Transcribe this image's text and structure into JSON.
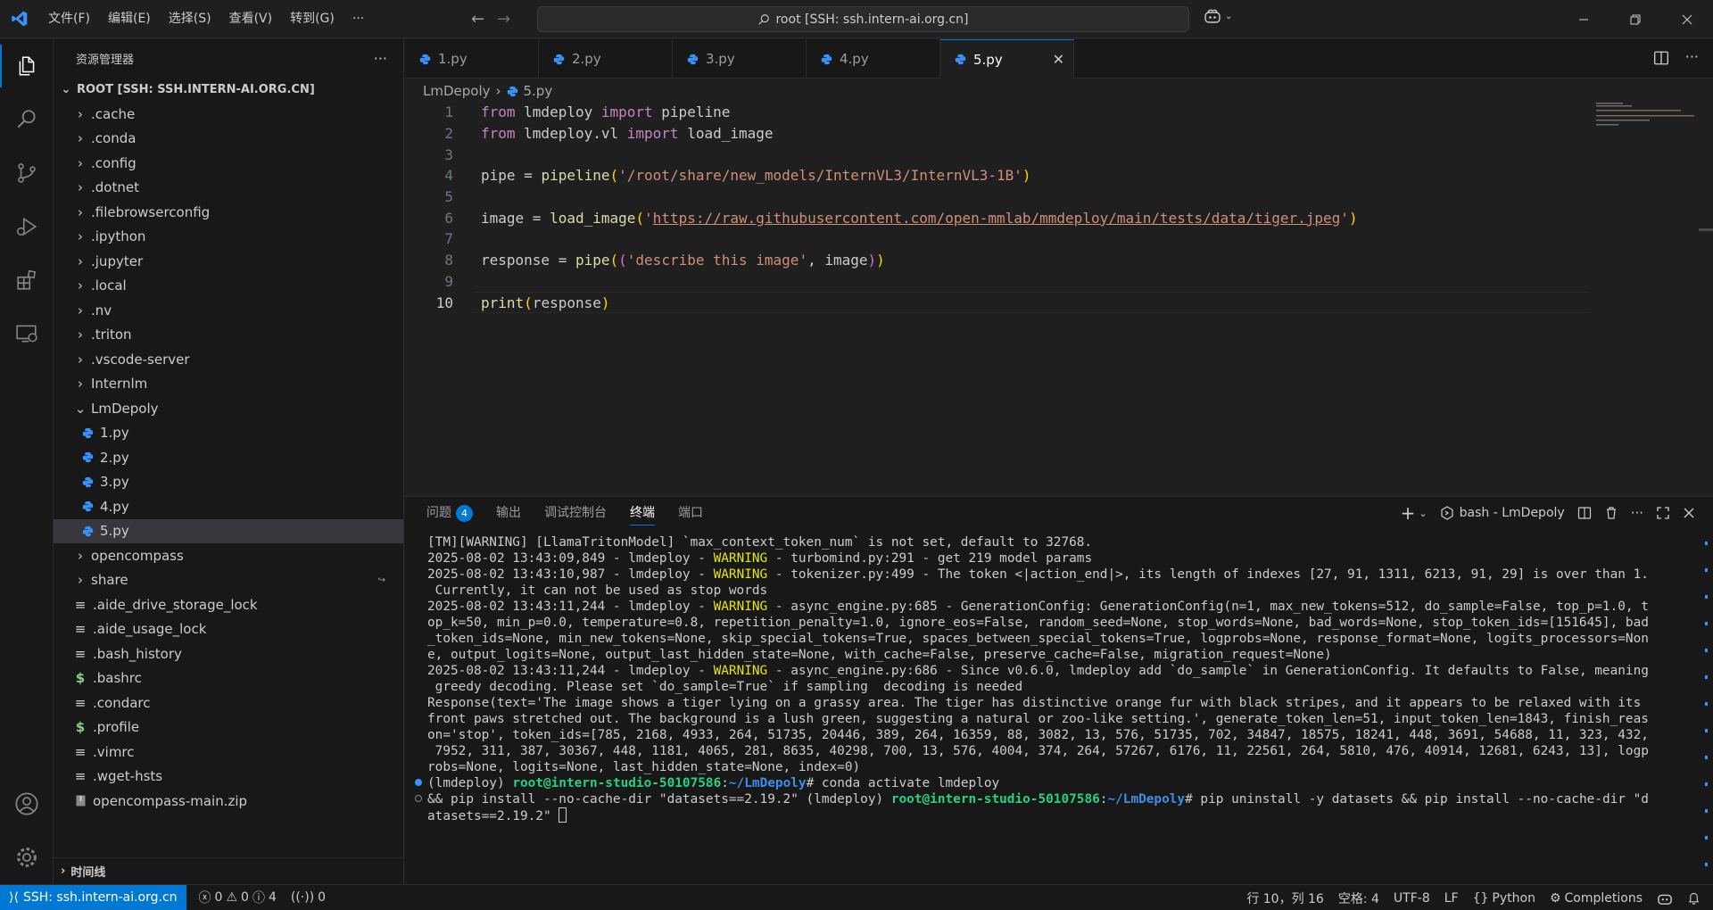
{
  "menu": [
    "文件(F)",
    "编辑(E)",
    "选择(S)",
    "查看(V)",
    "转到(G)"
  ],
  "search": {
    "text": "root [SSH: ssh.intern-ai.org.cn]"
  },
  "sidebar": {
    "title": "资源管理器",
    "root": "ROOT [SSH: SSH.INTERN-AI.ORG.CN]",
    "folders": [
      ".cache",
      ".conda",
      ".config",
      ".dotnet",
      ".filebrowserconfig",
      ".ipython",
      ".jupyter",
      ".local",
      ".nv",
      ".triton",
      ".vscode-server",
      "Internlm"
    ],
    "open_folder": "LmDepoly",
    "lmdepoly_files": [
      "1.py",
      "2.py",
      "3.py",
      "4.py",
      "5.py"
    ],
    "more_folders": [
      "opencompass",
      "share"
    ],
    "files": [
      {
        "name": ".aide_drive_storage_lock",
        "icon": "lines"
      },
      {
        "name": ".aide_usage_lock",
        "icon": "lines"
      },
      {
        "name": ".bash_history",
        "icon": "lines"
      },
      {
        "name": ".bashrc",
        "icon": "dollar"
      },
      {
        "name": ".condarc",
        "icon": "lines"
      },
      {
        "name": ".profile",
        "icon": "dollar"
      },
      {
        "name": ".vimrc",
        "icon": "lines"
      },
      {
        "name": ".wget-hsts",
        "icon": "lines"
      },
      {
        "name": "opencompass-main.zip",
        "icon": "zip"
      }
    ],
    "timeline": "时间线"
  },
  "tabs": [
    "1.py",
    "2.py",
    "3.py",
    "4.py",
    "5.py"
  ],
  "active_tab": "5.py",
  "breadcrumb": {
    "folder": "LmDepoly",
    "file": "5.py"
  },
  "code": {
    "line_numbers": [
      "1",
      "2",
      "3",
      "4",
      "5",
      "6",
      "7",
      "8",
      "9",
      "10"
    ],
    "pipe_path": "'/root/share/new_models/InternVL3/InternVL3-1B'",
    "image_url": "https://raw.githubusercontent.com/open-mmlab/mmdeploy/main/tests/data/tiger.jpeg",
    "prompt": "'describe this image'"
  },
  "panel": {
    "tabs": [
      "问题",
      "输出",
      "调试控制台",
      "终端",
      "端口"
    ],
    "problems_count": "4",
    "terminal_name": "bash - LmDepoly"
  },
  "terminal": {
    "lines": [
      "[TM][WARNING] [LlamaTritonModel] `max_context_token_num` is not set, default to 32768.",
      "",
      "",
      " Currently, it can not be used as stop words",
      "",
      "op_k=50, min_p=0.0, temperature=0.8, repetition_penalty=1.0, ignore_eos=False, random_seed=None, stop_words=None, bad_words=None, stop_token_ids=[151645], bad",
      "_token_ids=None, min_new_tokens=None, skip_special_tokens=True, spaces_between_special_tokens=True, logprobs=None, response_format=None, logits_processors=Non",
      "e, output_logits=None, output_last_hidden_state=None, with_cache=False, preserve_cache=False, migration_request=None)",
      "",
      " greedy decoding. Please set `do_sample=True` if sampling  decoding is needed",
      "Response(text='The image shows a tiger lying on a grassy area. The tiger has distinctive orange fur with black stripes, and it appears to be relaxed with its",
      "front paws stretched out. The background is a lush green, suggesting a natural or zoo-like setting.', generate_token_len=51, input_token_len=1843, finish_reas",
      "on='stop', token_ids=[785, 2168, 4933, 264, 51735, 20446, 389, 264, 16359, 88, 3082, 13, 576, 51735, 702, 34847, 18575, 18241, 448, 3691, 54688, 11, 323, 432,",
      " 7952, 311, 387, 30367, 448, 1181, 4065, 281, 8635, 40298, 700, 13, 576, 4004, 374, 264, 57267, 6176, 11, 22561, 264, 5810, 476, 40914, 12681, 6243, 13], logp",
      "robs=None, logits=None, last_hidden_state=None, index=0)"
    ],
    "warn_lines": [
      {
        "ts": "2025-08-02 13:43:09,849 - lmdeploy - ",
        "lvl": "WARNING",
        "msg": " - turbomind.py:291 - get 219 model params"
      },
      {
        "ts": "2025-08-02 13:43:10,987 - lmdeploy - ",
        "lvl": "WARNING",
        "msg": " - tokenizer.py:499 - The token <|action_end|>, its length of indexes [27, 91, 1311, 6213, 91, 29] is over than 1."
      },
      {
        "ts": "2025-08-02 13:43:11,244 - lmdeploy - ",
        "lvl": "WARNING",
        "msg": " - async_engine.py:685 - GenerationConfig: GenerationConfig(n=1, max_new_tokens=512, do_sample=False, top_p=1.0, t"
      },
      {
        "ts": "2025-08-02 13:43:11,244 - lmdeploy - ",
        "lvl": "WARNING",
        "msg": " - async_engine.py:686 - Since v0.6.0, lmdeploy add `do_sample` in GenerationConfig. It defaults to False, meaning"
      }
    ],
    "prompt_user": "root@intern-studio-50107586",
    "prompt_path": "~/LmDepoly",
    "cmd1": "# conda activate lmdeploy",
    "cmd2_prefix": "&& pip install --no-cache-dir \"datasets==2.19.2\" (lmdeploy) ",
    "cmd2": "# pip uninstall -y datasets && pip install --no-cache-dir \"d",
    "cmd2_tail": "atasets==2.19.2\" "
  },
  "status": {
    "remote": "SSH: ssh.intern-ai.org.cn",
    "errors": "0",
    "warnings": "0",
    "infos": "4",
    "ports": "0",
    "position": "行 10，列 16",
    "spaces": "空格: 4",
    "encoding": "UTF-8",
    "eol": "LF",
    "language": "Python",
    "completions": "Completions"
  },
  "colors": {
    "accent": "#0078d4",
    "python_icon": "#3794ff"
  }
}
